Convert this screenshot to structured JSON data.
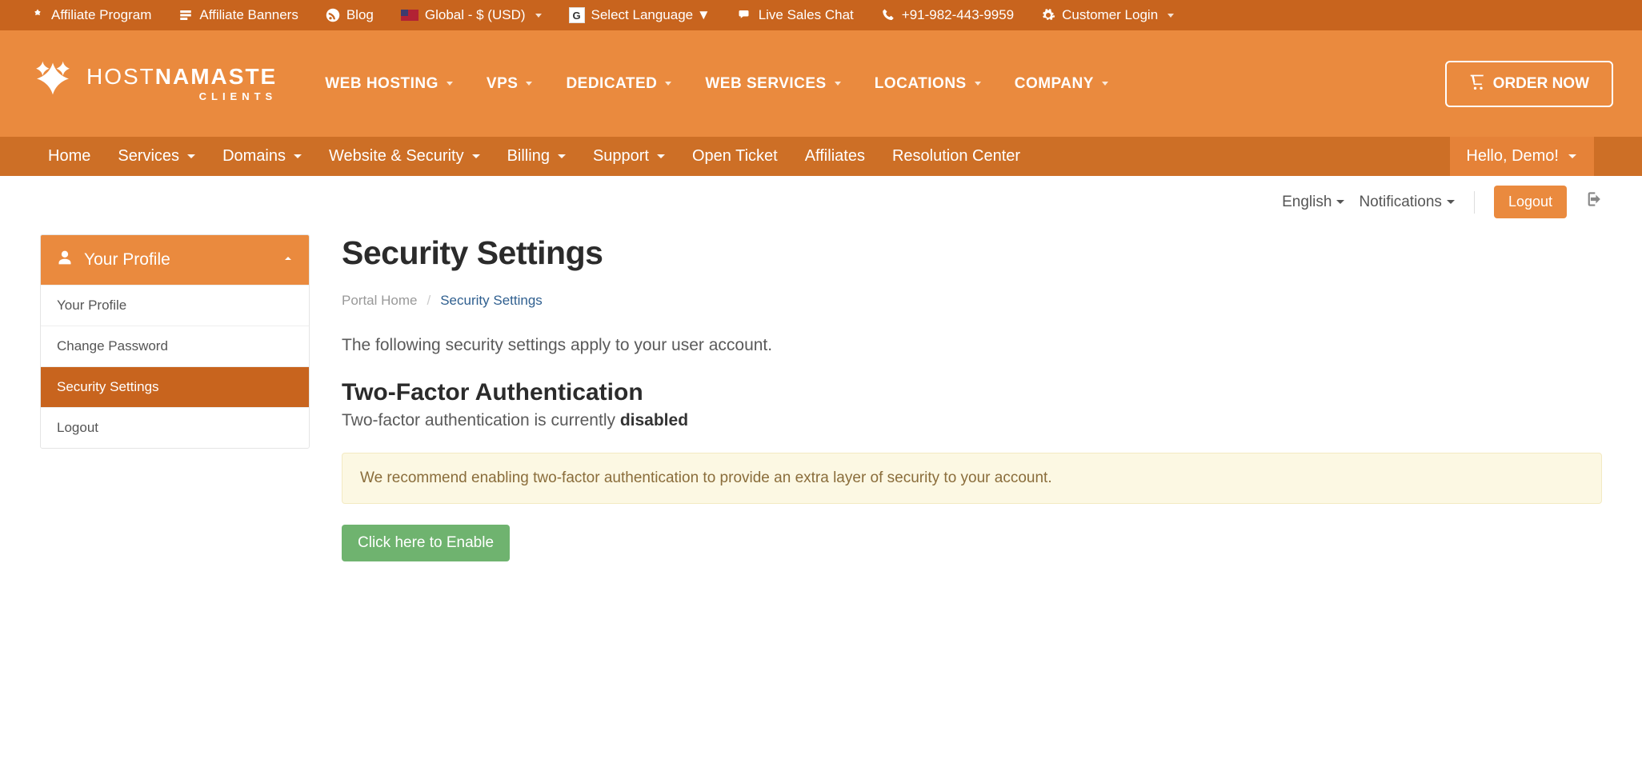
{
  "topbar": {
    "affiliate_program": "Affiliate Program",
    "affiliate_banners": "Affiliate Banners",
    "blog": "Blog",
    "currency": "Global - $ (USD)",
    "language_select": "Select Language ▼",
    "live_chat": "Live Sales Chat",
    "phone": "+91-982-443-9959",
    "customer_login": "Customer Login"
  },
  "brand": {
    "name1": "HOST",
    "name2": "NAMASTE",
    "sub": "CLIENTS"
  },
  "mainnav": {
    "items": [
      "WEB HOSTING",
      "VPS",
      "DEDICATED",
      "WEB SERVICES",
      "LOCATIONS",
      "COMPANY"
    ],
    "order": "ORDER NOW"
  },
  "subnav": {
    "items": [
      "Home",
      "Services",
      "Domains",
      "Website & Security",
      "Billing",
      "Support",
      "Open Ticket",
      "Affiliates",
      "Resolution Center"
    ],
    "hello": "Hello, Demo!"
  },
  "util": {
    "language": "English",
    "notifications": "Notifications",
    "logout": "Logout"
  },
  "sidebar": {
    "header": "Your Profile",
    "items": [
      "Your Profile",
      "Change Password",
      "Security Settings",
      "Logout"
    ],
    "active_index": 2
  },
  "content": {
    "title": "Security Settings",
    "breadcrumb_home": "Portal Home",
    "breadcrumb_sep": "/",
    "breadcrumb_current": "Security Settings",
    "lead": "The following security settings apply to your user account.",
    "tfa_heading": "Two-Factor Authentication",
    "tfa_text_prefix": "Two-factor authentication is currently ",
    "tfa_status": "disabled",
    "alert": "We recommend enabling two-factor authentication to provide an extra layer of security to your account.",
    "enable_btn": "Click here to Enable"
  }
}
